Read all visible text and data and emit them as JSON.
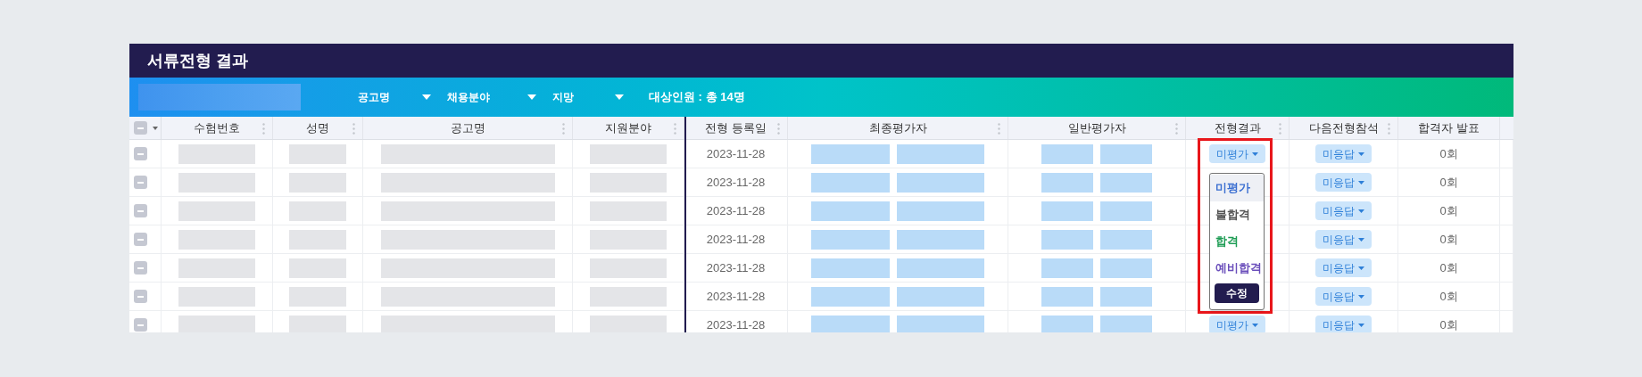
{
  "title": "서류전형 결과",
  "filter_bar": {
    "filters": [
      {
        "label": "공고명"
      },
      {
        "label": "채용분야"
      },
      {
        "label": "지망"
      }
    ],
    "target_count": "대상인원 : 총 14명"
  },
  "table": {
    "columns": [
      {
        "label": "수험번호"
      },
      {
        "label": "성명"
      },
      {
        "label": "공고명"
      },
      {
        "label": "지원분야"
      },
      {
        "label": "전형 등록일"
      },
      {
        "label": "최종평가자"
      },
      {
        "label": "일반평가자"
      },
      {
        "label": "전형결과"
      },
      {
        "label": "다음전형참석"
      },
      {
        "label": "합격자 발표"
      }
    ],
    "rows": [
      {
        "registered": "2023-11-28",
        "result": "미평가",
        "next": "미응답",
        "announce": "0회"
      },
      {
        "registered": "2023-11-28",
        "next": "미응답",
        "announce": "0회"
      },
      {
        "registered": "2023-11-28",
        "next": "미응답",
        "announce": "0회"
      },
      {
        "registered": "2023-11-28",
        "next": "미응답",
        "announce": "0회"
      },
      {
        "registered": "2023-11-28",
        "next": "미응답",
        "announce": "0회"
      },
      {
        "registered": "2023-11-28",
        "next": "미응답",
        "announce": "0회"
      },
      {
        "registered": "2023-11-28",
        "result": "미평가",
        "next": "미응답",
        "announce": "0회"
      }
    ]
  },
  "dropdown": {
    "options": [
      {
        "label": "미평가",
        "selected": true,
        "color": "#3b6fd1"
      },
      {
        "label": "불합격",
        "selected": false,
        "color": "#555555"
      },
      {
        "label": "합격",
        "selected": false,
        "color": "#1f9d55"
      },
      {
        "label": "예비합격",
        "selected": false,
        "color": "#6b4fbb"
      }
    ],
    "button": "수정"
  }
}
